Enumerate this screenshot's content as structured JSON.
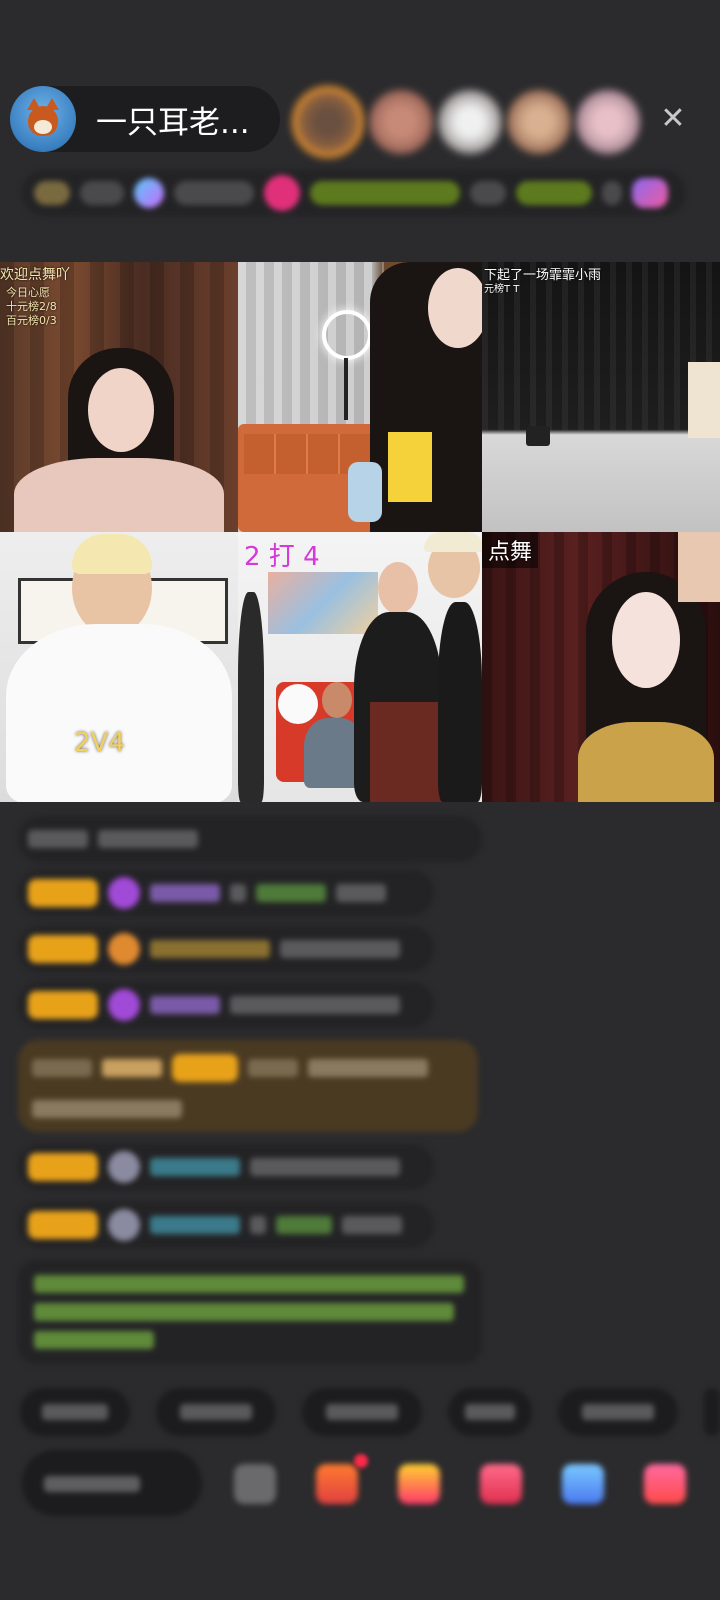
{
  "header": {
    "host_name": "一只耳老...",
    "close_icon": "close-icon"
  },
  "video_grid": {
    "tiles": [
      {
        "overlay_title": "欢迎点舞吖",
        "wish_lines": [
          "今日心愿",
          "十元榜2/8",
          "百元榜0/3"
        ]
      },
      {
        "overlay_title": ""
      },
      {
        "overlay_title": "下起了一场霏霏小雨",
        "sub_line": "元榜T T"
      },
      {
        "overlay_title": "",
        "score_label": "2V4"
      },
      {
        "overlay_title": "2 打 4"
      },
      {
        "overlay_title": "点舞"
      }
    ]
  },
  "colors": {
    "background": "#2b2b2d",
    "badge_gold": "#e8a21a",
    "green_text": "#8fd35a",
    "purple_gem": "#a14ad8",
    "avatar_ring": "#e49130"
  }
}
